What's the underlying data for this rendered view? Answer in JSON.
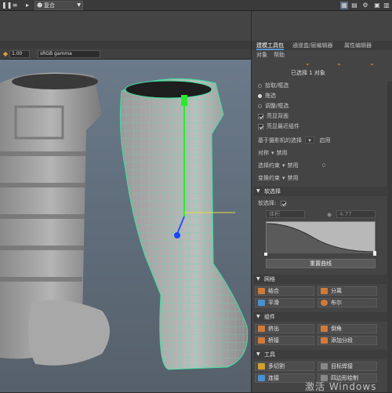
{
  "topbar": {
    "mode": "复合",
    "icons": [
      "pause-icon",
      "list-icon",
      "grid-icon",
      "layout-icon",
      "settings-icon",
      "help-icon"
    ]
  },
  "viewport_toolbar": {
    "value": "1.00",
    "colorspace": "sRGB gamma"
  },
  "panel": {
    "tabs": [
      "建模工具包",
      "通道盒/层编辑器",
      "属性编辑器"
    ],
    "menus": [
      "对象",
      "帮助"
    ],
    "selected": "已选择 1 对象",
    "pick_label": "拾取/框选",
    "drag_label": "拖选",
    "tweak_label": "调整/框选",
    "backface": "亮显背面",
    "nearest": "亮显最近组件",
    "camera_select": "基于摄影机的选择",
    "camera_select_state": "启用",
    "symmetry": "对称",
    "symmetry_value": "禁用",
    "selection_constraint": "选择约束",
    "selection_constraint_value": "禁用",
    "transform_constraint": "变换约束",
    "transform_constraint_value": "禁用",
    "constraint_number": "0",
    "soft_select": "软选择",
    "soft_select_label": "软选择:",
    "falloff_mode": "体积",
    "falloff_value": "4.77",
    "reset_curve": "重置曲线",
    "mesh_section": "网格",
    "mesh_tools": [
      "结合",
      "分离",
      "平滑",
      "布尔"
    ],
    "components_section": "组件",
    "component_tools": [
      "挤出",
      "倒角",
      "桥接",
      "添加分段"
    ],
    "tools_section": "工具",
    "tools": [
      "多切割",
      "目标焊接",
      "连接",
      "四边形绘制"
    ]
  },
  "watermark": "激活 Windows",
  "colors": {
    "accent": "#5a8fc8",
    "wire": "#3fe0a0",
    "boot": "#9a9a9a"
  }
}
